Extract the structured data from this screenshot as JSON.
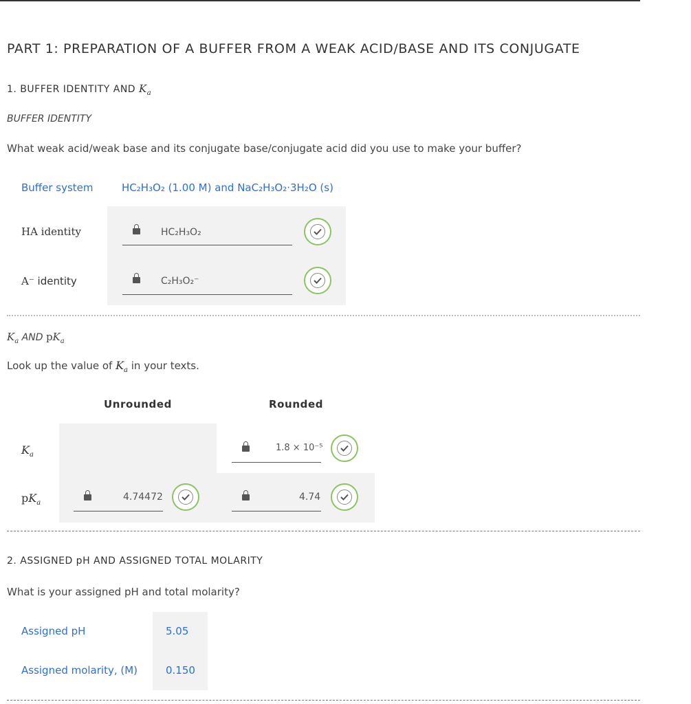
{
  "part_title": "PART 1: PREPARATION OF A BUFFER FROM A WEAK ACID/BASE AND ITS CONJUGATE",
  "section1": {
    "title": "1. BUFFER IDENTITY AND",
    "title_var": "Ka",
    "subtitle": "BUFFER IDENTITY",
    "question": "What weak acid/weak base and its conjugate base/conjugate acid did you use to make your buffer?",
    "buffer_system_label": "Buffer system",
    "buffer_system_value": "HC₂H₃O₂ (1.00 M) and NaC₂H₃O₂·3H₂O (s)",
    "ha_label": "HA identity",
    "ha_value": "HC₂H₃O₂",
    "a_label": "identity",
    "a_symbol": "A⁻",
    "a_value": "C₂H₃O₂⁻"
  },
  "ka_section": {
    "subtitle_pre": "AND",
    "question_pre": "Look up the value of",
    "question_post": "in your texts.",
    "col_unrounded": "Unrounded",
    "col_rounded": "Rounded",
    "ka_row_label": "Ka",
    "pka_row_label": "pKa",
    "ka_unrounded": "",
    "ka_rounded": "1.8 × 10⁻⁵",
    "pka_unrounded": "4.74472",
    "pka_rounded": "4.74"
  },
  "section2": {
    "title": "2. ASSIGNED pH AND ASSIGNED TOTAL MOLARITY",
    "question": "What is your assigned pH and total molarity?",
    "ph_label": "Assigned pH",
    "ph_value": "5.05",
    "molarity_label": "Assigned molarity, (M)",
    "molarity_value": "0.150"
  },
  "colors": {
    "accent_blue": "#2c6fd6",
    "check_green": "#8ac462",
    "field_bg": "#f2f2f2"
  }
}
